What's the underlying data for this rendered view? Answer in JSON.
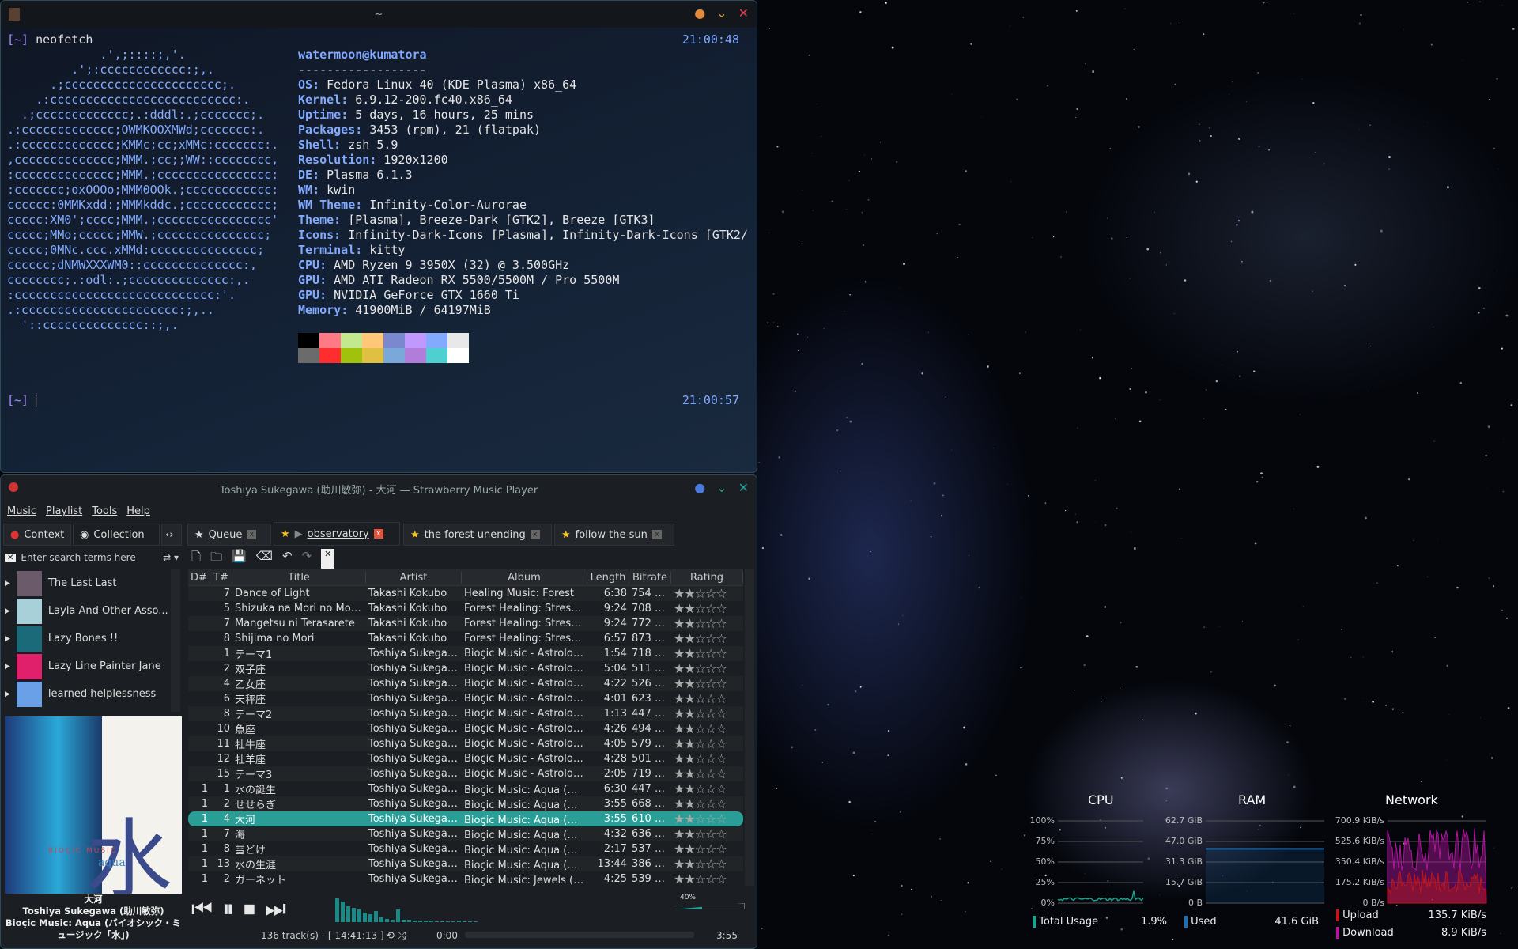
{
  "terminal": {
    "title": "~",
    "prompt": "[~]",
    "command": "neofetch",
    "time1": "21:00:48",
    "time2": "21:00:57",
    "ascii": [
      "             .',;::::;,'.",
      "         .';:cccccccccccc:;,.",
      "      .;cccccccccccccccccccccc;.",
      "    .:cccccccccccccccccccccccccc:.",
      "  .;ccccccccccccc;.:dddl:.;ccccccc;.",
      ".:ccccccccccccc;OWMKOOXMWd;ccccccc:.",
      ".:ccccccccccccc;KMMc;cc;xMMc:ccccccc:.",
      ",cccccccccccccc;MMM.;cc;;WW::cccccccc,",
      ":cccccccccccccc;MMM.;cccccccccccccccc:",
      ":ccccccc;oxOOOo;MMM0OOk.;cccccccccccc:",
      "cccccc:0MMKxdd:;MMMkddc.;cccccccccccc;",
      "ccccc:XM0';cccc;MMM.;cccccccccccccccc'",
      "ccccc;MMo;ccccc;MMW.;ccccccccccccccc;",
      "ccccc;0MNc.ccc.xMMd:ccccccccccccccc;",
      "cccccc;dNMWXXXWM0::cccccccccccccc:,",
      "cccccccc;.:odl:.;cccccccccccccc:,.",
      ":cccccccccccccccccccccccccccc:'.",
      ".:cccccccccccccccccccccc:;,..",
      "  '::cccccccccccccc::;,."
    ],
    "user": "watermoon@kumatora",
    "sep": "------------------",
    "info": [
      [
        "OS",
        "Fedora Linux 40 (KDE Plasma) x86_64"
      ],
      [
        "Kernel",
        "6.9.12-200.fc40.x86_64"
      ],
      [
        "Uptime",
        "5 days, 16 hours, 25 mins"
      ],
      [
        "Packages",
        "3453 (rpm), 21 (flatpak)"
      ],
      [
        "Shell",
        "zsh 5.9"
      ],
      [
        "Resolution",
        "1920x1200"
      ],
      [
        "DE",
        "Plasma 6.1.3"
      ],
      [
        "WM",
        "kwin"
      ],
      [
        "WM Theme",
        "Infinity-Color-Aurorae"
      ],
      [
        "Theme",
        "[Plasma], Breeze-Dark [GTK2], Breeze [GTK3]"
      ],
      [
        "Icons",
        "Infinity-Dark-Icons [Plasma], Infinity-Dark-Icons [GTK2/"
      ],
      [
        "Terminal",
        "kitty"
      ],
      [
        "CPU",
        "AMD Ryzen 9 3950X (32) @ 3.500GHz"
      ],
      [
        "GPU",
        "AMD ATI Radeon RX 5500/5500M / Pro 5500M"
      ],
      [
        "GPU",
        "NVIDIA GeForce GTX 1660 Ti"
      ],
      [
        "Memory",
        "41900MiB / 64197MiB"
      ]
    ],
    "palette": [
      "#000000",
      "#ff7a85",
      "#c3e88d",
      "#ffc777",
      "#7a88cf",
      "#c099ff",
      "#82aaff",
      "#e8e8e8",
      "#6b6b6b",
      "#ff2d2d",
      "#a0c20c",
      "#e0c040",
      "#7aa8d8",
      "#b07ed8",
      "#4fd0d0",
      "#ffffff"
    ]
  },
  "player": {
    "title": "Toshiya Sukegawa (助川敏弥) - 大河 — Strawberry Music Player",
    "menu": [
      "Music",
      "Playlist",
      "Tools",
      "Help"
    ],
    "side_tabs": [
      "Context",
      "Collection"
    ],
    "playlist_tabs": [
      "Queue",
      "observatory",
      "the forest unending",
      "follow the sun"
    ],
    "search_placeholder": "Enter search terms here",
    "library": [
      "The Last Last",
      "Layla And Other Asso...",
      "Lazy Bones !!",
      "Lazy Line Painter Jane",
      "learned helplessness"
    ],
    "columns": [
      "D#",
      "T#",
      "Title",
      "Artist",
      "Album",
      "Length",
      "Bitrate",
      "Rating"
    ],
    "tracks": [
      [
        "",
        "7",
        "Dance of Light",
        "Takashi Kokubo",
        "Healing Music: Forest",
        "6:38",
        "754 kbps"
      ],
      [
        "",
        "5",
        "Shizuka na Mori no Mon...",
        "Takashi Kokubo",
        "Forest Healing: Stress R...",
        "9:24",
        "708 kbps"
      ],
      [
        "",
        "7",
        "Mangetsu ni Terasarete",
        "Takashi Kokubo",
        "Forest Healing: Stress R...",
        "9:24",
        "772 kbps"
      ],
      [
        "",
        "8",
        "Shijima no Mori",
        "Takashi Kokubo",
        "Forest Healing: Stress R...",
        "6:57",
        "873 kbps"
      ],
      [
        "",
        "1",
        "テーマ1",
        "Toshiya Sukegaw...",
        "Bioçic Music - Astrology...",
        "1:54",
        "718 kbps"
      ],
      [
        "",
        "2",
        "双子座",
        "Toshiya Sukegaw...",
        "Bioçic Music - Astrology...",
        "5:04",
        "511 kbps"
      ],
      [
        "",
        "4",
        "乙女座",
        "Toshiya Sukegaw...",
        "Bioçic Music - Astrology...",
        "4:22",
        "526 kbps"
      ],
      [
        "",
        "6",
        "天秤座",
        "Toshiya Sukegaw...",
        "Bioçic Music - Astrology...",
        "4:01",
        "623 kbps"
      ],
      [
        "",
        "8",
        "テーマ2",
        "Toshiya Sukegaw...",
        "Bioçic Music - Astrology...",
        "1:13",
        "447 kbps"
      ],
      [
        "",
        "10",
        "魚座",
        "Toshiya Sukegaw...",
        "Bioçic Music - Astrology...",
        "4:26",
        "494 kbps"
      ],
      [
        "",
        "11",
        "牡牛座",
        "Toshiya Sukegaw...",
        "Bioçic Music - Astrology...",
        "4:05",
        "579 kbps"
      ],
      [
        "",
        "12",
        "牡羊座",
        "Toshiya Sukegaw...",
        "Bioçic Music - Astrology...",
        "4:28",
        "501 kbps"
      ],
      [
        "",
        "15",
        "テーマ3",
        "Toshiya Sukegaw...",
        "Bioçic Music - Astrology...",
        "2:05",
        "719 kbps"
      ],
      [
        "1",
        "1",
        "水の誕生",
        "Toshiya Sukegaw...",
        "Bioçic Music: Aqua (バ...",
        "6:30",
        "447 kbps"
      ],
      [
        "1",
        "2",
        "せせらぎ",
        "Toshiya Sukegaw...",
        "Bioçic Music: Aqua (バ...",
        "3:55",
        "668 kbps"
      ],
      [
        "1",
        "4",
        "大河",
        "Toshiya Sukegaw...",
        "Bioçic Music: Aqua (バ...",
        "3:55",
        "610 kbps"
      ],
      [
        "1",
        "7",
        "海",
        "Toshiya Sukegaw...",
        "Bioçic Music: Aqua (バ...",
        "4:32",
        "636 kbps"
      ],
      [
        "1",
        "8",
        "雪どけ",
        "Toshiya Sukegaw...",
        "Bioçic Music: Aqua (バ...",
        "2:17",
        "537 kbps"
      ],
      [
        "1",
        "13",
        "水の生涯",
        "Toshiya Sukegaw...",
        "Bioçic Music: Aqua (バ...",
        "13:44",
        "386 kbps"
      ],
      [
        "1",
        "2",
        "ガーネット",
        "Toshiya Sukegaw...",
        "Bioçic Music: Jewels (バ...",
        "4:25",
        "539 kbps"
      ]
    ],
    "current_index": 15,
    "rating_stars": 2,
    "album_art": {
      "artist": "Toshiya Sukegawa",
      "series": "BIOÇIC MUSIC",
      "name": "aqua",
      "kanji": "水"
    },
    "now_playing": {
      "title": "大河",
      "artist": "Toshiya Sukegawa (助川敏弥)",
      "album": "Bioçic Music: Aqua (バイオシック・ミュージック「水」)"
    },
    "volume": "40%",
    "status": "136 track(s) - [ 14:41:13 ]",
    "position": "0:00",
    "duration": "3:55",
    "accent": "#2a9d96"
  },
  "widgets": {
    "cpu": {
      "title": "CPU",
      "ticks": [
        "100%",
        "75%",
        "50%",
        "25%",
        "0%"
      ],
      "legend": "Total Usage",
      "value": "1.9%",
      "color": "#1aa38f"
    },
    "ram": {
      "title": "RAM",
      "ticks": [
        "62.7 GiB",
        "47.0 GiB",
        "31.3 GiB",
        "15.7 GiB",
        "0 B"
      ],
      "legend": "Used",
      "value": "41.6 GiB",
      "used_fraction": 0.66,
      "color": "#1f6fb0"
    },
    "network": {
      "title": "Network",
      "ticks": [
        "700.9 KiB/s",
        "525.6 KiB/s",
        "350.4 KiB/s",
        "175.2 KiB/s",
        "0 B/s"
      ],
      "upload_label": "Upload",
      "upload": "135.7 KiB/s",
      "download_label": "Download",
      "download": "8.9 KiB/s",
      "upload_color": "#c0161e",
      "download_color": "#b0169e"
    }
  }
}
